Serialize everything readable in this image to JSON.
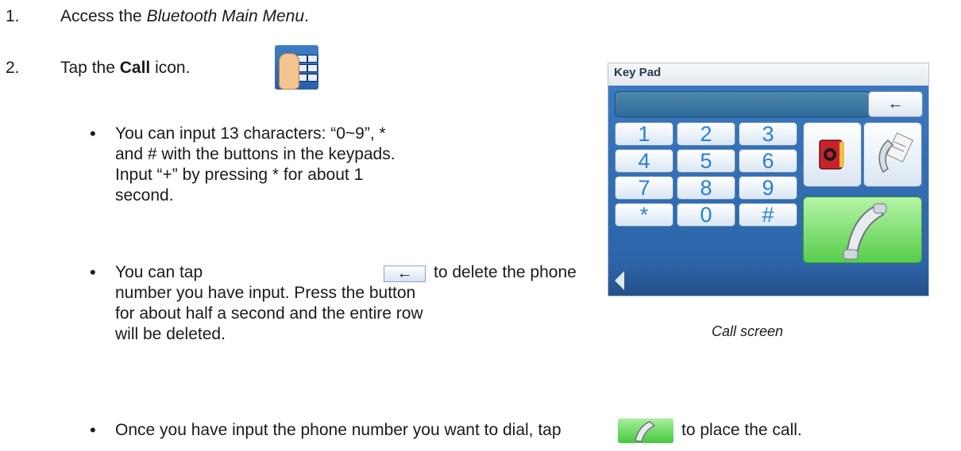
{
  "steps": [
    {
      "number": "1.",
      "prefix": "Access the ",
      "emph": "Bluetooth Main Menu",
      "suffix": "."
    },
    {
      "number": "2.",
      "prefix": "Tap the ",
      "bold": "Call",
      "suffix": " icon."
    }
  ],
  "bullets": {
    "b1": [
      "You can input 13 characters: “0~9”, *",
      "and # with the buttons in the keypads.",
      "Input “+” by pressing * for about 1",
      "second."
    ],
    "b2_line1_a": "You can tap",
    "b2_line1_b": "to delete the phone",
    "b2_rest": [
      "number you have input. Press the button",
      "for about half a second and the entire row",
      "will be deleted."
    ],
    "b3_a": "Once you have input the phone number you want to dial, tap",
    "b3_b": "to place the call."
  },
  "bullet_glyph": "•",
  "inline_back_arrow": "←",
  "screen": {
    "title": "Key Pad",
    "back_arrow": "←",
    "keys": [
      "1",
      "2",
      "3",
      "4",
      "5",
      "6",
      "7",
      "8",
      "9",
      "*",
      "0",
      "#"
    ],
    "icons": {
      "contacts": "phonebook-icon",
      "history": "call-log-icon",
      "dial": "handset-icon",
      "nav_back": "back-triangle-icon"
    }
  },
  "caption": "Call screen",
  "colors": {
    "keypad_blue": "#2c64a8",
    "key_text": "#2a7fd3",
    "dial_green": "#58cd4c"
  }
}
